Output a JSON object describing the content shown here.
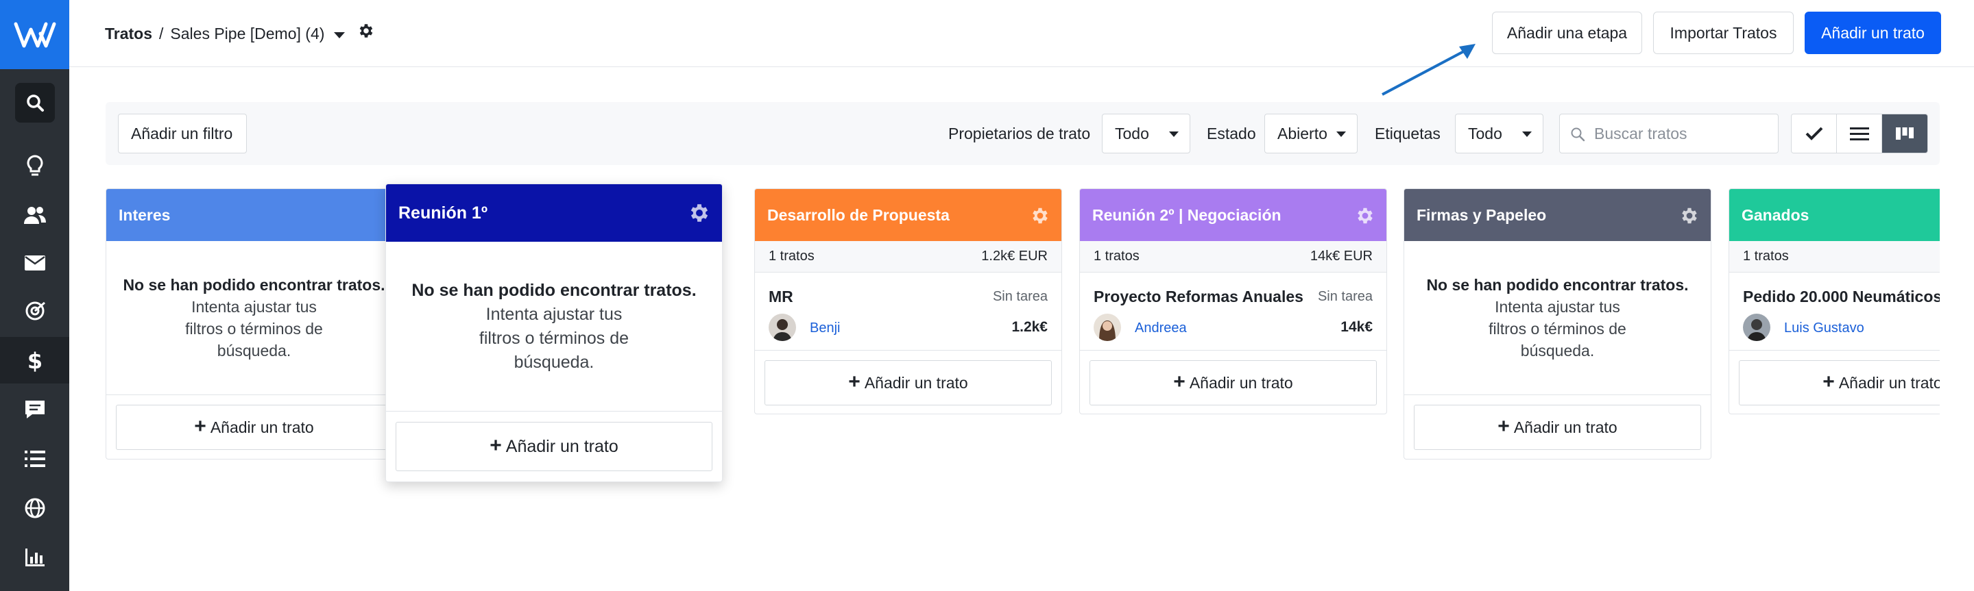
{
  "topbar": {
    "breadcrumb_root": "Tratos",
    "breadcrumb_sep": "/",
    "pipeline_name": "Sales Pipe [Demo] (4)",
    "add_stage": "Añadir una etapa",
    "import_deals": "Importar Tratos",
    "add_deal": "Añadir un trato"
  },
  "filters": {
    "add_filter": "Añadir un filtro",
    "owners_label": "Propietarios de trato",
    "owners_value": "Todo",
    "status_label": "Estado",
    "status_value": "Abierto",
    "tags_label": "Etiquetas",
    "tags_value": "Todo",
    "search_placeholder": "Buscar tratos"
  },
  "empty": {
    "title": "No se han podido encontrar tratos.",
    "line1": "Intenta ajustar tus",
    "line2": "filtros o términos de",
    "line3": "búsqueda."
  },
  "add_deal_label": "Añadir un trato",
  "stages": [
    {
      "name": "Interes",
      "color": "#4f86e8"
    },
    {
      "name": "Reunión 1º",
      "color": "#0a13a8"
    },
    {
      "name": "Desarrollo de Propuesta",
      "color": "#fd8130",
      "count": "1 tratos",
      "total": "1.2k€ EUR",
      "deal": {
        "title": "MR",
        "task": "Sin tarea",
        "owner": "Benji",
        "amount": "1.2k€"
      }
    },
    {
      "name": "Reunión 2º | Negociación",
      "color": "#a97cf0",
      "count": "1 tratos",
      "total": "14k€ EUR",
      "deal": {
        "title": "Proyecto Reformas Anuales",
        "task": "Sin tarea",
        "owner": "Andreea",
        "amount": "14k€"
      }
    },
    {
      "name": "Firmas y Papeleo",
      "color": "#585e72"
    },
    {
      "name": "Ganados",
      "color": "#1fc99a",
      "count": "1 tratos",
      "deal": {
        "title": "Pedido 20.000 Neumáticos",
        "owner": "Luis Gustavo"
      }
    }
  ],
  "colors": {
    "sidebar": "#2b3036",
    "logo": "#1a73e8",
    "primary": "#0a5cf5",
    "arrow": "#1a6fc4"
  }
}
